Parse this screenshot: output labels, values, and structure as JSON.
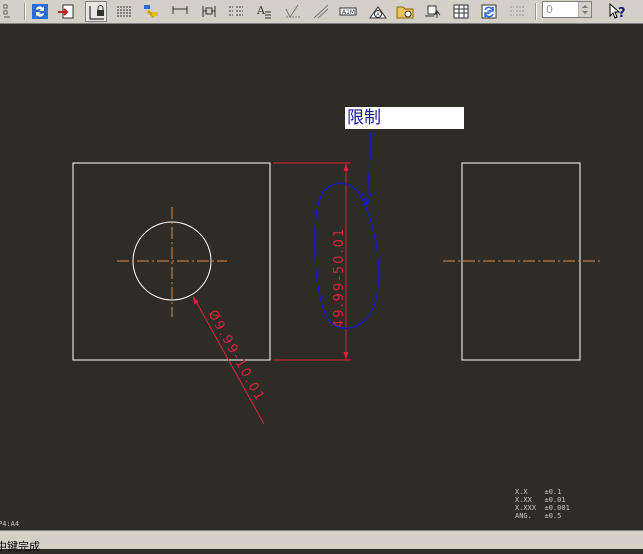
{
  "toolbar": {
    "buttons": [
      {
        "name": "layout-icon"
      },
      {
        "name": "regenerate-icon"
      },
      {
        "name": "import-icon"
      },
      {
        "name": "lock-view-icon"
      },
      {
        "name": "note-icon"
      },
      {
        "name": "show-annotations-icon"
      },
      {
        "name": "dimension-icon"
      },
      {
        "name": "ordinate-dimension-icon"
      },
      {
        "name": "reference-dimension-icon"
      },
      {
        "name": "text-style-icon"
      },
      {
        "name": "surface-finish-icon"
      },
      {
        "name": "slash-icon"
      },
      {
        "name": "datum-icon"
      },
      {
        "name": "balloon-icon"
      },
      {
        "name": "symbol-icon"
      },
      {
        "name": "move-icon"
      },
      {
        "name": "table-icon"
      },
      {
        "name": "repeat-region-icon"
      },
      {
        "name": "list-icon"
      }
    ],
    "spin_value": "0",
    "help_label": "?"
  },
  "drawing": {
    "note_text": "限制",
    "dim_vertical": "49.99-50.01",
    "dim_diameter": "Ø9.99-10.01",
    "sheet_label": "P4:A4",
    "tolerance_table": [
      "X.X    ±0.1",
      "X.XX   ±0.01",
      "X.XXX  ±0.001",
      "ANG.   ±0.5"
    ]
  },
  "colors": {
    "background": "#2e2c27",
    "geometry": "#ffffff",
    "centerline": "#e08a3c",
    "dimension": "#e0203c",
    "markup": "#1a1ac8"
  },
  "status": {
    "message": "中键完成"
  }
}
